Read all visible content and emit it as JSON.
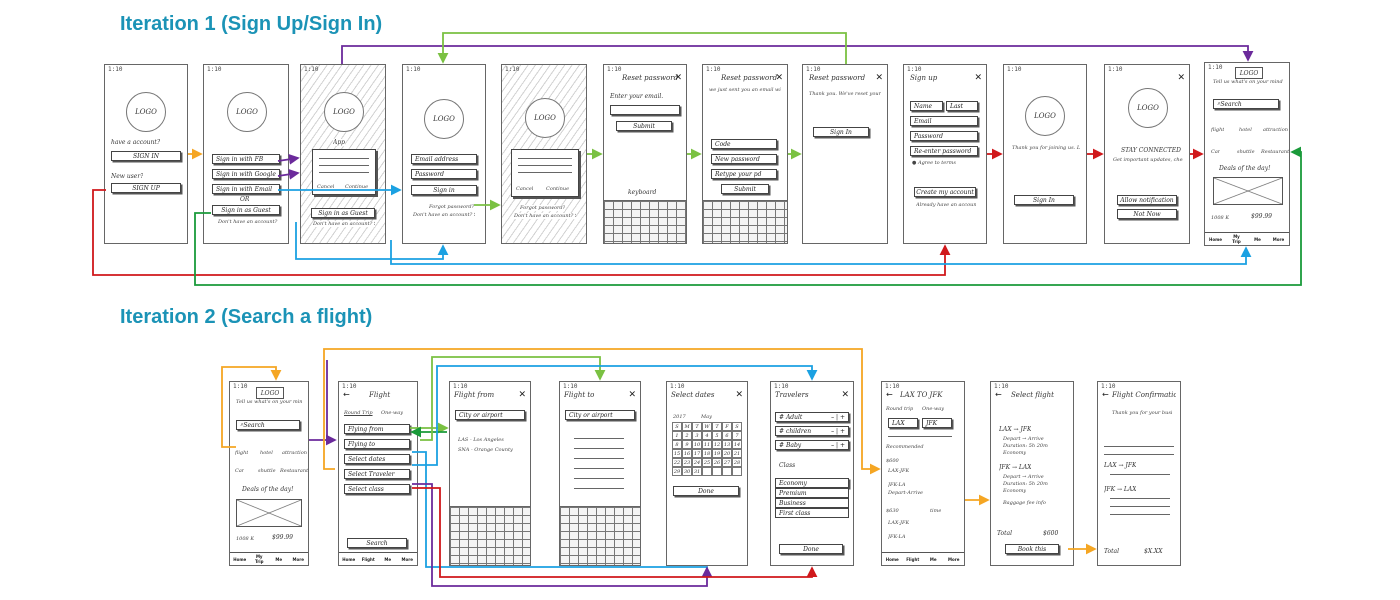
{
  "titles": {
    "iteration1": "Iteration 1 (Sign Up/Sign In)",
    "iteration2": "Iteration 2 (Search a flight)"
  },
  "status_time": "1:10",
  "icons": {
    "close": "close-icon",
    "back": "back-arrow-icon",
    "logo": "logo-circle"
  },
  "colors": {
    "title": "#1b93b6",
    "orange": "#f5a623",
    "purple": "#6b2a9b",
    "blue": "#1ba1e2",
    "green": "#7ac142",
    "red": "#d0181b",
    "darkgreen": "#1a9a3a"
  },
  "iter1": {
    "s1": {
      "logo": "LOGO",
      "have_account": "have a account?",
      "sign_in": "SIGN IN",
      "new_user": "New user?",
      "sign_up": "SIGN UP"
    },
    "s2": {
      "logo": "LOGO",
      "fb": "Sign in with FB",
      "google": "Sign in with Google",
      "email": "Sign in with Email",
      "or": "OR",
      "guest": "Sign in as Guest",
      "no_account": "Don't have an account? Sign up."
    },
    "s3": {
      "logo": "LOGO",
      "app": "App",
      "cancel": "Cancel",
      "continue": "Continue",
      "guest": "Sign in as Guest",
      "no_account": "Don't have an account? Sign up"
    },
    "s4": {
      "logo": "LOGO",
      "email": "Email address",
      "password": "Password",
      "sign_in": "Sign in",
      "forgot": "Forgot password?",
      "no_account": "Don't have an account? Sign up."
    },
    "s5": {
      "logo": "LOGO",
      "cancel": "Cancel",
      "continue": "Continue",
      "forgot": "Forgot password?",
      "no_account": "Don't have an account? Sign up"
    },
    "s6": {
      "title": "Reset password",
      "enter_email": "Enter your email.",
      "submit": "Submit",
      "keyboard": "keyboard"
    },
    "s7": {
      "title": "Reset password",
      "body": "we just sent you an email with password reset code. please check your email and reset your pd.",
      "code": "Code",
      "new_password": "New password",
      "retype": "Retype your pd",
      "submit": "Submit"
    },
    "s8": {
      "title": "Reset password",
      "body": "Thank you. We've reset your password.",
      "sign_in": "Sign In"
    },
    "s9": {
      "title": "Sign up",
      "name": "Name",
      "last": "Last",
      "email": "Email",
      "password": "Password",
      "retype": "Re-enter password",
      "agree": "Agree to terms",
      "create": "Create my account",
      "already": "Already have an account? Sign in"
    },
    "s10": {
      "logo": "LOGO",
      "body": "Thank you for joining us. Let's us take care your business. Call your need and get SOGO.",
      "sign_in": "Sign In"
    },
    "s11": {
      "logo": "LOGO",
      "stay": "STAY CONNECTED",
      "body": "Get important updates, check in reminders, flight delays by allowing push notification.",
      "allow": "Allow notification",
      "not_now": "Not Now"
    },
    "s12": {
      "logo": "LOGO",
      "tell": "Tell us what's on your mind. We'll help you!",
      "search": "Search",
      "cats": [
        "flight",
        "hotel",
        "attraction",
        "Car",
        "shuttle",
        "Restaurant"
      ],
      "deals": "Deals of the day!",
      "price": "$99.99",
      "count": "1008 K",
      "tabs": [
        "Home",
        "My Trip",
        "Me",
        "More"
      ]
    }
  },
  "iter2": {
    "h": {
      "logo": "LOGO",
      "tell": "Tell us what's on your mind. We'll help you!",
      "search": "Search",
      "cats": [
        "flight",
        "hotel",
        "attraction",
        "Car",
        "shuttle",
        "Restaurant"
      ],
      "deals": "Deals of the day!",
      "price": "$99.99",
      "count": "1008 K",
      "tabs": [
        "Home",
        "My Trip",
        "Me",
        "More"
      ]
    },
    "f": {
      "title": "Flight",
      "round": "Round Trip",
      "oneway": "One-way",
      "from": "Flying from",
      "to": "Flying to",
      "dates": "Select dates",
      "travelers": "Select Traveler",
      "class": "Select class",
      "search": "Search",
      "tabs": [
        "Home",
        "Flight",
        "Me",
        "More"
      ]
    },
    "ff": {
      "title": "Flight from",
      "search": "City or airport",
      "r1": "LAS - Los Angeles",
      "r2": "SNA - Orange County"
    },
    "ft": {
      "title": "Flight to",
      "search": "City or airport"
    },
    "sd": {
      "title": "Select dates",
      "year": "2017",
      "month": "May",
      "done": "Done",
      "days": [
        "S",
        "M",
        "T",
        "W",
        "T",
        "F",
        "S",
        "1",
        "2",
        "3",
        "4",
        "5",
        "6",
        "7",
        "8",
        "9",
        "10",
        "11",
        "12",
        "13",
        "14",
        "15",
        "16",
        "17",
        "18",
        "19",
        "20",
        "21",
        "22",
        "23",
        "24",
        "25",
        "26",
        "27",
        "28",
        "29",
        "30",
        "31",
        "",
        "",
        "",
        ""
      ]
    },
    "tr": {
      "title": "Travelers",
      "adult": "Adult",
      "children": "children",
      "baby": "Baby",
      "hash": "#",
      "class": "Class",
      "c1": "Economy",
      "c2": "Premium",
      "c3": "Business",
      "c4": "First class",
      "done": "Done"
    },
    "res": {
      "title": "LAX TO JFK",
      "round": "Round trip",
      "oneway": "One-way",
      "lax": "LAX",
      "jfk": "JFK",
      "recommend": "Recommended",
      "p1": "$600",
      "p2": "$630",
      "f1": "LAX-JFK",
      "f2": "JFK-LA",
      "time": "time",
      "depart": "Depart-Arrive",
      "tabs": [
        "Home",
        "Flight",
        "Me",
        "More"
      ]
    },
    "sf": {
      "title": "Select flight",
      "r1": "LAX → JFK",
      "r2": "JFK → LAX",
      "depart": "Depart → Arrive",
      "duration": "Duration: 5h 20m",
      "economy": "Economy",
      "baggage": "Baggage fee info",
      "total": "Total",
      "amount": "$600",
      "book": "Book this"
    },
    "cf": {
      "title": "Flight Confirmation",
      "body": "Thank you for your business. Here is your receipt.",
      "r1": "LAX → JFK",
      "r2": "JFK → LAX",
      "total": "Total",
      "amount": "$X.XX"
    }
  }
}
